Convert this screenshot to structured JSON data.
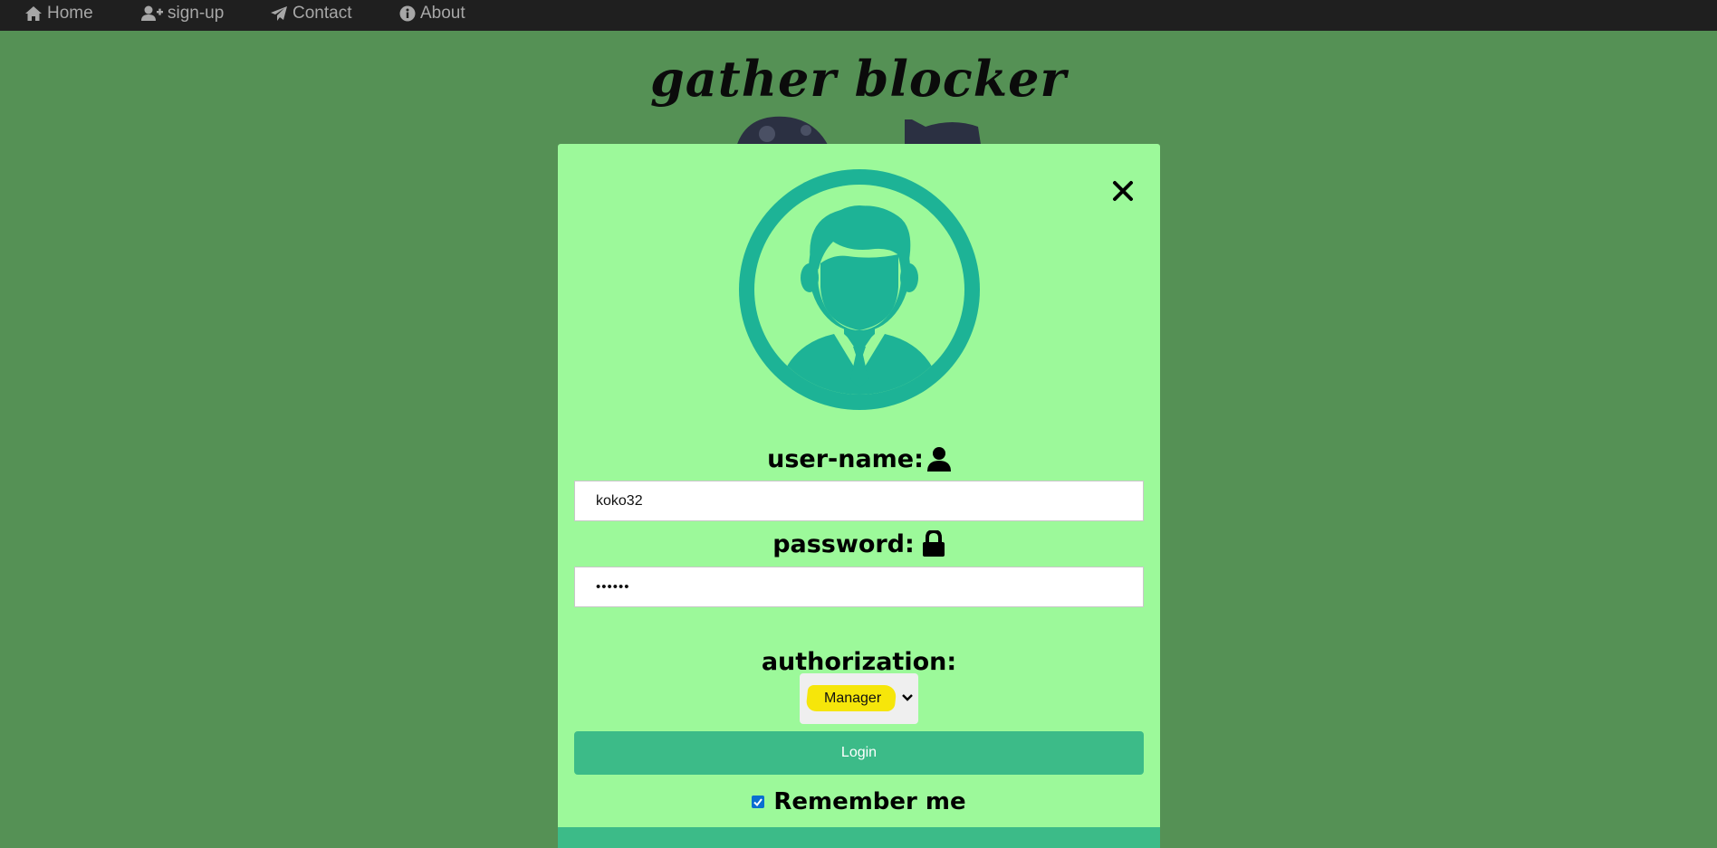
{
  "nav": {
    "home": "Home",
    "signup": "sign-up",
    "contact": "Contact",
    "about": "About"
  },
  "site_title": "gather blocker",
  "login_form": {
    "username_label": "user-name:",
    "username_value": "koko32",
    "password_label": "password:",
    "password_value": "••••••",
    "authorization_label": "authorization:",
    "authorization_selected": "Manager",
    "login_button": "Login",
    "remember_label": "Remember me",
    "remember_checked": true
  },
  "colors": {
    "page_bg": "#559155",
    "nav_bg": "#1f1f1f",
    "modal_bg": "#9cf99a",
    "accent": "#3cbb88",
    "avatar": "#1db396",
    "highlight": "#f6e60a"
  },
  "icons": [
    "home-icon",
    "user-plus-icon",
    "paper-plane-icon",
    "info-icon",
    "close-icon",
    "user-icon",
    "lock-icon",
    "chevron-down-icon",
    "avatar-icon"
  ]
}
